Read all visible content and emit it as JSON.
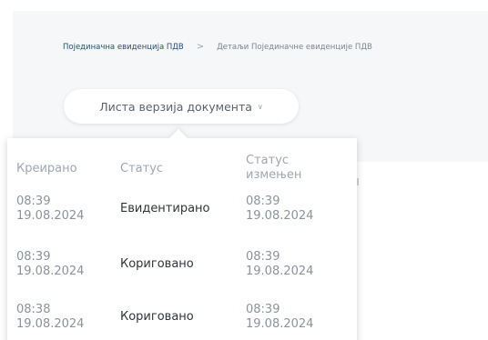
{
  "breadcrumb": {
    "link": "Појединачна евиденција ПДВ",
    "separator": ">",
    "current": "Детаљи Појединачне евиденције ПДВ"
  },
  "version_button": {
    "label": "Листа верзија документа",
    "icon": "chevron-down-icon"
  },
  "versions": {
    "headers": [
      "Креирано",
      "Статус",
      "Статус",
      "измењен"
    ],
    "rows": [
      {
        "created_time": "08:39",
        "created_date": "19.08.2024",
        "status": "Евидентирано",
        "changed_time": "08:39",
        "changed_date": "19.08.2024"
      },
      {
        "created_time": "08:39",
        "created_date": "19.08.2024",
        "status": "Кориговано",
        "changed_time": "08:39",
        "changed_date": "19.08.2024"
      },
      {
        "created_time": "08:38",
        "created_date": "19.08.2024",
        "status": "Кориговано",
        "changed_time": "08:39",
        "changed_date": "19.08.2024"
      }
    ]
  }
}
